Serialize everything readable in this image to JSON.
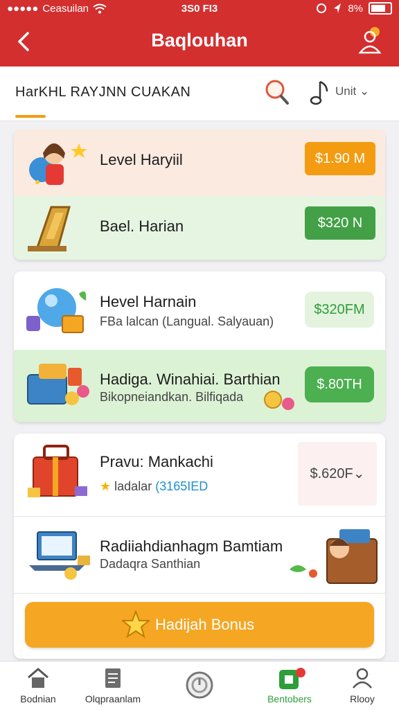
{
  "status_bar": {
    "carrier": "Ceasuilan",
    "time": "3S0 FI3",
    "battery_percent": "8%"
  },
  "header": {
    "title": "Baqlouhan"
  },
  "subheader": {
    "tab_label": "HarKHL RAYJNN CUAKAN",
    "sort_label": "Unit"
  },
  "group1": {
    "rows": [
      {
        "name": "Level Haryiil",
        "price": "$1.90 M",
        "icon": "girl-avatar-icon"
      },
      {
        "name": "Bael. Harian",
        "price": "$320 N",
        "icon": "gold-tablet-icon"
      }
    ]
  },
  "group2": {
    "rows": [
      {
        "name": "Hevel Harnain",
        "subtitle": "FBa lalcan (Langual. Salyauan)",
        "price": "$320FM",
        "icon": "crystal-ball-icon"
      },
      {
        "name": "Hadiga. Winahiai. Barthian",
        "subtitle": "Bikopneiandkan. Bilfiqada",
        "price": "$.80TH",
        "icon": "treasure-box-icon"
      }
    ]
  },
  "group3": {
    "rows": [
      {
        "name": "Pravu: Mankachi",
        "subtitle": "ladalar",
        "subtitle_highlight": "(3165IED",
        "price": "$.620F",
        "icon": "red-chest-icon"
      },
      {
        "name": "Radiiahdianhagm Bamtiam",
        "subtitle": "Dadaqra Santhian",
        "icon": "laptop-icon"
      }
    ]
  },
  "bonus_button": {
    "label": "Hadijah Bonus"
  },
  "bottom_nav": [
    {
      "label": "Bodnian",
      "icon": "home-icon"
    },
    {
      "label": "Olqpraanlam",
      "icon": "document-icon"
    },
    {
      "label": "",
      "icon": "center-circle-icon"
    },
    {
      "label": "Bentobers",
      "icon": "gift-icon"
    },
    {
      "label": "Rlooy",
      "icon": "user-icon"
    }
  ],
  "colors": {
    "header_red": "#d32f2f",
    "orange": "#f39c12",
    "green": "#43a047",
    "nav_active": "#2e9d3a"
  }
}
